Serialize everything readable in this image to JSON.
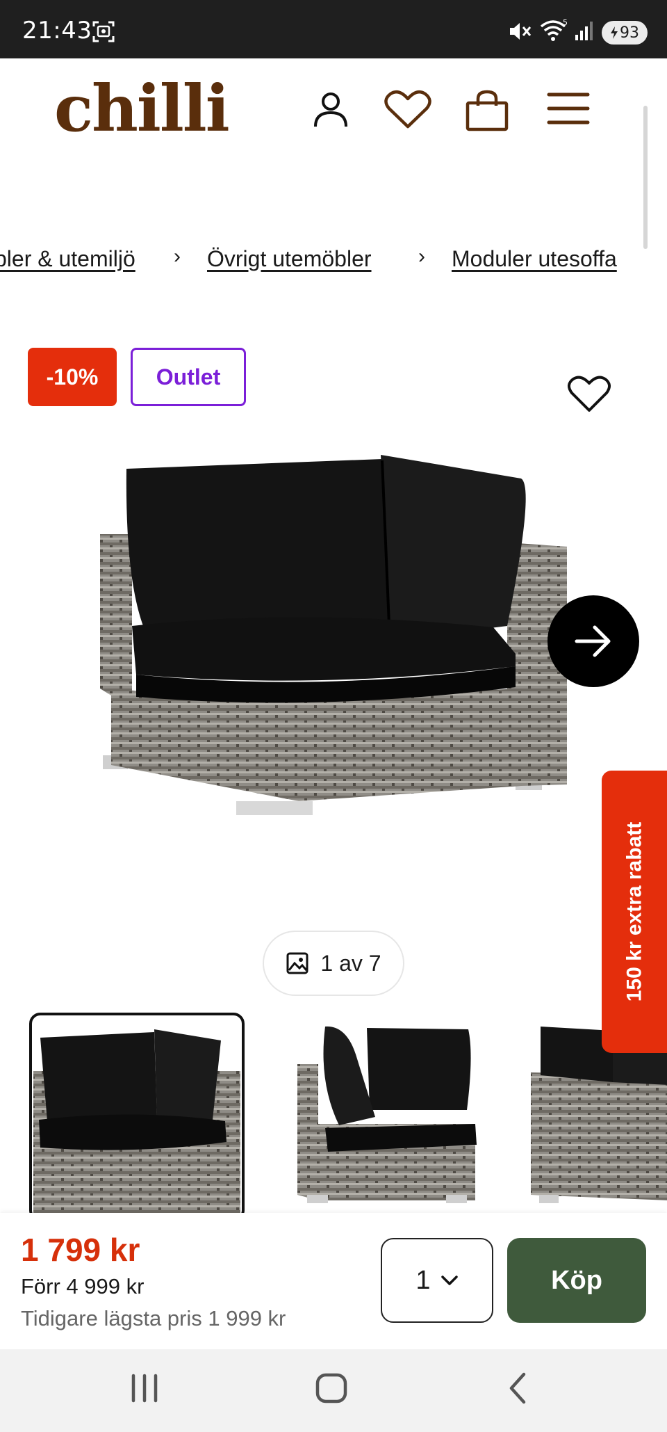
{
  "status_bar": {
    "time": "21:43",
    "battery": "93",
    "icons": [
      "screenshot-icon",
      "mute-icon",
      "wifi-icon",
      "signal-icon",
      "battery-icon"
    ]
  },
  "header": {
    "logo": "chilli",
    "brand_color": "#5a2e0c",
    "icons": [
      "account-icon",
      "heart-icon",
      "cart-icon",
      "menu-icon"
    ]
  },
  "breadcrumb": {
    "items": [
      "bler & utemiljö",
      "Övrigt utemöbler",
      "Moduler utesoffa"
    ],
    "separator": "›"
  },
  "badges": {
    "discount": "-10%",
    "outlet": "Outlet",
    "discount_color": "#e42e0c",
    "outlet_color": "#7b1fd8"
  },
  "gallery": {
    "counter": "1 av 7",
    "current": 1,
    "total": 7
  },
  "side_tab": {
    "label": "150 kr extra rabatt"
  },
  "buy_bar": {
    "price": "1 799 kr",
    "previous_price": "Förr 4 999 kr",
    "lowest_price": "Tidigare lägsta pris 1 999 kr",
    "quantity": "1",
    "buy_label": "Köp",
    "buy_color": "#3f5a3c",
    "price_color": "#d6300a"
  },
  "nav_bar": {
    "icons": [
      "recents-icon",
      "home-icon",
      "back-icon"
    ]
  }
}
